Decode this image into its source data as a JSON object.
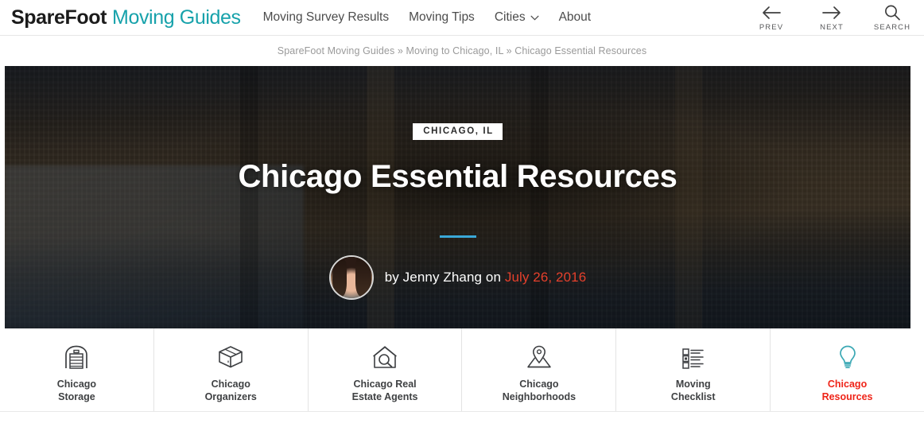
{
  "header": {
    "logo_dark": "SpareFoot",
    "logo_teal": "Moving Guides",
    "nav": [
      {
        "label": "Moving Survey Results",
        "icon": ""
      },
      {
        "label": "Moving Tips",
        "icon": ""
      },
      {
        "label": "Cities",
        "icon": "chevron-down-icon"
      },
      {
        "label": "About",
        "icon": ""
      }
    ],
    "tools": [
      {
        "label": "PREV",
        "icon": "arrow-left-icon"
      },
      {
        "label": "NEXT",
        "icon": "arrow-right-icon"
      },
      {
        "label": "SEARCH",
        "icon": "search-icon"
      }
    ]
  },
  "breadcrumb": {
    "text": "SpareFoot Moving Guides » Moving to Chicago, IL » Chicago Essential Resources"
  },
  "hero": {
    "badge": "CHICAGO, IL",
    "title": "Chicago Essential Resources",
    "byline_prefix": "by Jenny Zhang on",
    "byline_date": "July 26, 2016",
    "avatar_icon": "author-avatar",
    "divider_color": "#3aa8d8"
  },
  "tiles": [
    {
      "label": "Chicago\nStorage",
      "icon": "storage-unit-icon",
      "active": false
    },
    {
      "label": "Chicago\nOrganizers",
      "icon": "moving-box-icon",
      "active": false
    },
    {
      "label": "Chicago Real\nEstate Agents",
      "icon": "house-search-icon",
      "active": false
    },
    {
      "label": "Chicago\nNeighborhoods",
      "icon": "map-pin-icon",
      "active": false
    },
    {
      "label": "Moving\nChecklist",
      "icon": "checklist-icon",
      "active": false
    },
    {
      "label": "Chicago\nResources",
      "icon": "lightbulb-icon",
      "active": true
    }
  ],
  "colors": {
    "brand_teal": "#17a2ab",
    "accent_red": "#ef2418",
    "date_red": "#e5402c",
    "divider_blue": "#3aa8d8",
    "text_dark": "#3f4143",
    "text_muted": "#9a9a9a"
  }
}
